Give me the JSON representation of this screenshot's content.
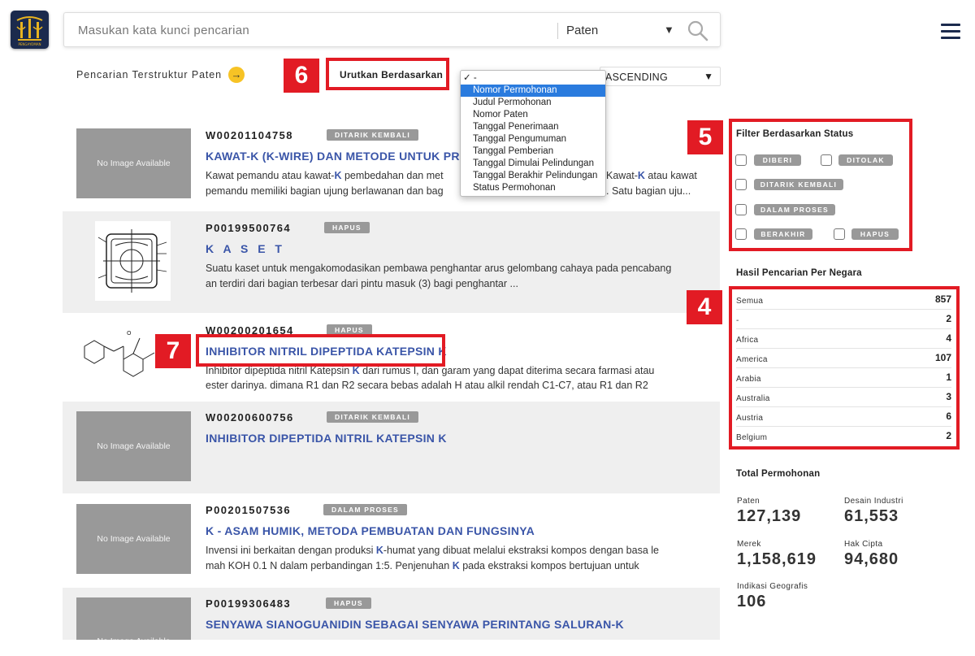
{
  "header": {
    "logo_text": "PENGAYOMAN",
    "search_placeholder": "Masukan kata kunci pencarian",
    "search_category": "Paten"
  },
  "toolbar": {
    "structured_search_label": "Pencarian Terstruktur Paten",
    "sort_label": "Urutkan Berdasarkan",
    "sort_order": "ASCENDING",
    "sort_options": [
      "-",
      "Nomor Permohonan",
      "Judul Permohonan",
      "Nomor Paten",
      "Tanggal Penerimaan",
      "Tanggal Pengumuman",
      "Tanggal Pemberian",
      "Tanggal Dimulai Pelindungan",
      "Tanggal Berakhir Pelindungan",
      "Status Permohonan"
    ]
  },
  "callouts": [
    "4",
    "5",
    "6",
    "7"
  ],
  "results": [
    {
      "id": "W00201104758",
      "status": "DITARIK KEMBALI",
      "title": "KAWAT-K (K-WIRE) DAN METODE UNTUK PRO",
      "desc1_pre": "Kawat pemandu atau kawat-",
      "desc1_k": "K",
      "desc1_post": " pembedahan dan met",
      "desc1_tail_pre": "Kawat-",
      "desc1_tail_k": "K",
      "desc1_tail_post": " atau kawat",
      "desc2": "pemandu memiliki bagian ujung berlawanan dan bag",
      "desc2_tail": ". Satu bagian uju...",
      "image": "No Image Available"
    },
    {
      "id": "P00199500764",
      "status": "HAPUS",
      "title": "K A S E T",
      "desc1": "Suatu kaset untuk mengakomodasikan pembawa penghantar arus gelombang cahaya pada pencabang",
      "desc2": "an terdiri dari bagian terbesar dari pintu masuk (3) bagi penghantar ..."
    },
    {
      "id": "W00200201654",
      "status": "HAPUS",
      "title": "INHIBITOR NITRIL DIPEPTIDA KATEPSIN K",
      "desc1_pre": "Inhibitor dipeptida nitril Katepsin ",
      "desc1_k": "K",
      "desc1_post": " dari rumus I, dan garam yang dapat diterima secara farmasi atau",
      "desc2": "ester darinya. dimana R1 dan R2 secara bebas adalah H atau alkil rendah C1-C7, atau R1 dan R2"
    },
    {
      "id": "W00200600756",
      "status": "DITARIK KEMBALI",
      "title": "INHIBITOR DIPEPTIDA NITRIL KATEPSIN K",
      "image": "No Image Available"
    },
    {
      "id": "P00201507536",
      "status": "DALAM PROSES",
      "title": "K - ASAM HUMIK, METODA PEMBUATAN DAN FUNGSINYA",
      "desc1_pre": "Invensi ini berkaitan dengan produksi ",
      "desc1_k": "K",
      "desc1_post": "-humat yang dibuat melalui ekstraksi kompos dengan basa le",
      "desc2_pre": "mah KOH 0.1 N dalam perbandingan 1:5. Penjenuhan ",
      "desc2_k": "K",
      "desc2_post": " pada ekstraksi kompos bertujuan untuk",
      "image": "No Image Available"
    },
    {
      "id": "P00199306483",
      "status": "HAPUS",
      "title": "SENYAWA SIANOGUANIDIN SEBAGAI SENYAWA PERINTANG SALURAN-K",
      "image": "No Image Available"
    }
  ],
  "filter": {
    "title": "Filter Berdasarkan Status",
    "statuses": [
      "DIBERI",
      "DITOLAK",
      "DITARIK KEMBALI",
      "DALAM PROSES",
      "BERAKHIR",
      "HAPUS"
    ]
  },
  "countries": {
    "title": "Hasil Pencarian Per Negara",
    "rows": [
      {
        "name": "Semua",
        "count": "857"
      },
      {
        "name": "-",
        "count": "2"
      },
      {
        "name": "Africa",
        "count": "4"
      },
      {
        "name": "America",
        "count": "107"
      },
      {
        "name": "Arabia",
        "count": "1"
      },
      {
        "name": "Australia",
        "count": "3"
      },
      {
        "name": "Austria",
        "count": "6"
      },
      {
        "name": "Belgium",
        "count": "2"
      }
    ]
  },
  "totals": {
    "title": "Total Permohonan",
    "items": [
      {
        "label": "Paten",
        "value": "127,139"
      },
      {
        "label": "Desain Industri",
        "value": "61,553"
      },
      {
        "label": "Merek",
        "value": "1,158,619"
      },
      {
        "label": "Hak Cipta",
        "value": "94,680"
      },
      {
        "label": "Indikasi Geografis",
        "value": "106"
      }
    ]
  },
  "colors": {
    "accent": "#3a55a8",
    "callout": "#e21b24",
    "tag": "#999999",
    "logo_bg": "#1b2a4d"
  }
}
